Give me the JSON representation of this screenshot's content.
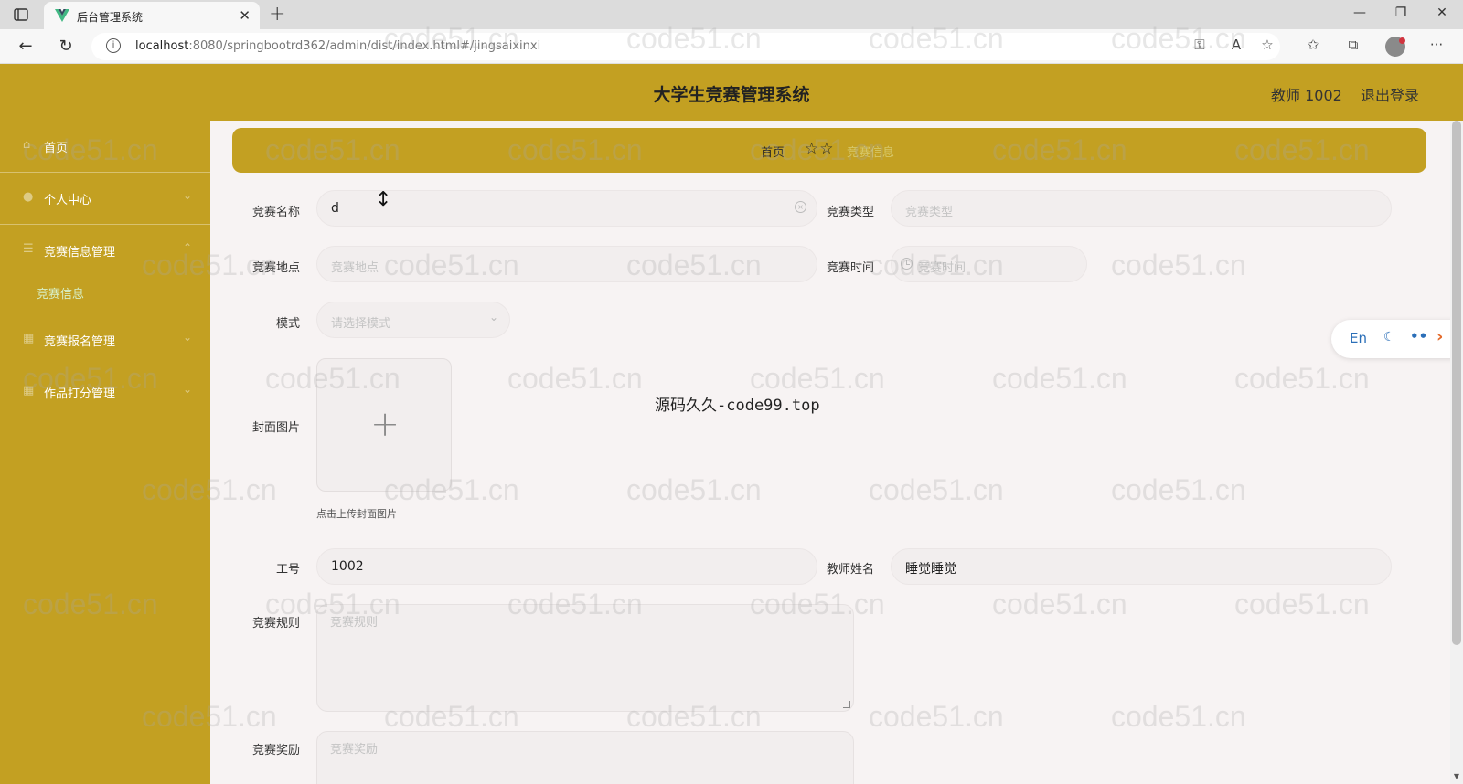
{
  "browser": {
    "tab_title": "后台管理系统",
    "url_host": "localhost",
    "url_rest": ":8080/springbootrd362/admin/dist/index.html#/jingsaixinxi"
  },
  "header": {
    "title": "大学生竞赛管理系统",
    "user": "教师 1002",
    "logout": "退出登录"
  },
  "sidebar": {
    "items": [
      {
        "label": "首页",
        "icon": "home-icon"
      },
      {
        "label": "个人中心",
        "icon": "user-icon"
      },
      {
        "label": "竞赛信息管理",
        "icon": "list-icon"
      },
      {
        "label": "竞赛报名管理",
        "icon": "form-icon"
      },
      {
        "label": "作品打分管理",
        "icon": "grade-icon"
      }
    ],
    "subitem": "竞赛信息"
  },
  "breadcrumb": {
    "home": "首页",
    "current": "竞赛信息"
  },
  "form": {
    "name": {
      "label": "竞赛名称",
      "value": "d"
    },
    "type": {
      "label": "竞赛类型",
      "placeholder": "竞赛类型"
    },
    "location": {
      "label": "竞赛地点",
      "placeholder": "竞赛地点"
    },
    "time": {
      "label": "竞赛时间",
      "placeholder": "竞赛时间"
    },
    "mode": {
      "label": "模式",
      "placeholder": "请选择模式"
    },
    "cover": {
      "label": "封面图片",
      "tip": "点击上传封面图片"
    },
    "job_no": {
      "label": "工号",
      "value": "1002"
    },
    "teacher": {
      "label": "教师姓名",
      "value": "睡觉睡觉"
    },
    "rules": {
      "label": "竞赛规则",
      "placeholder": "竞赛规则"
    },
    "reward": {
      "label": "竞赛奖励",
      "placeholder": "竞赛奖励"
    }
  },
  "overlay_text": "源码久久-code99.top",
  "watermark": "code51.cn",
  "widget": {
    "lang": "En"
  }
}
